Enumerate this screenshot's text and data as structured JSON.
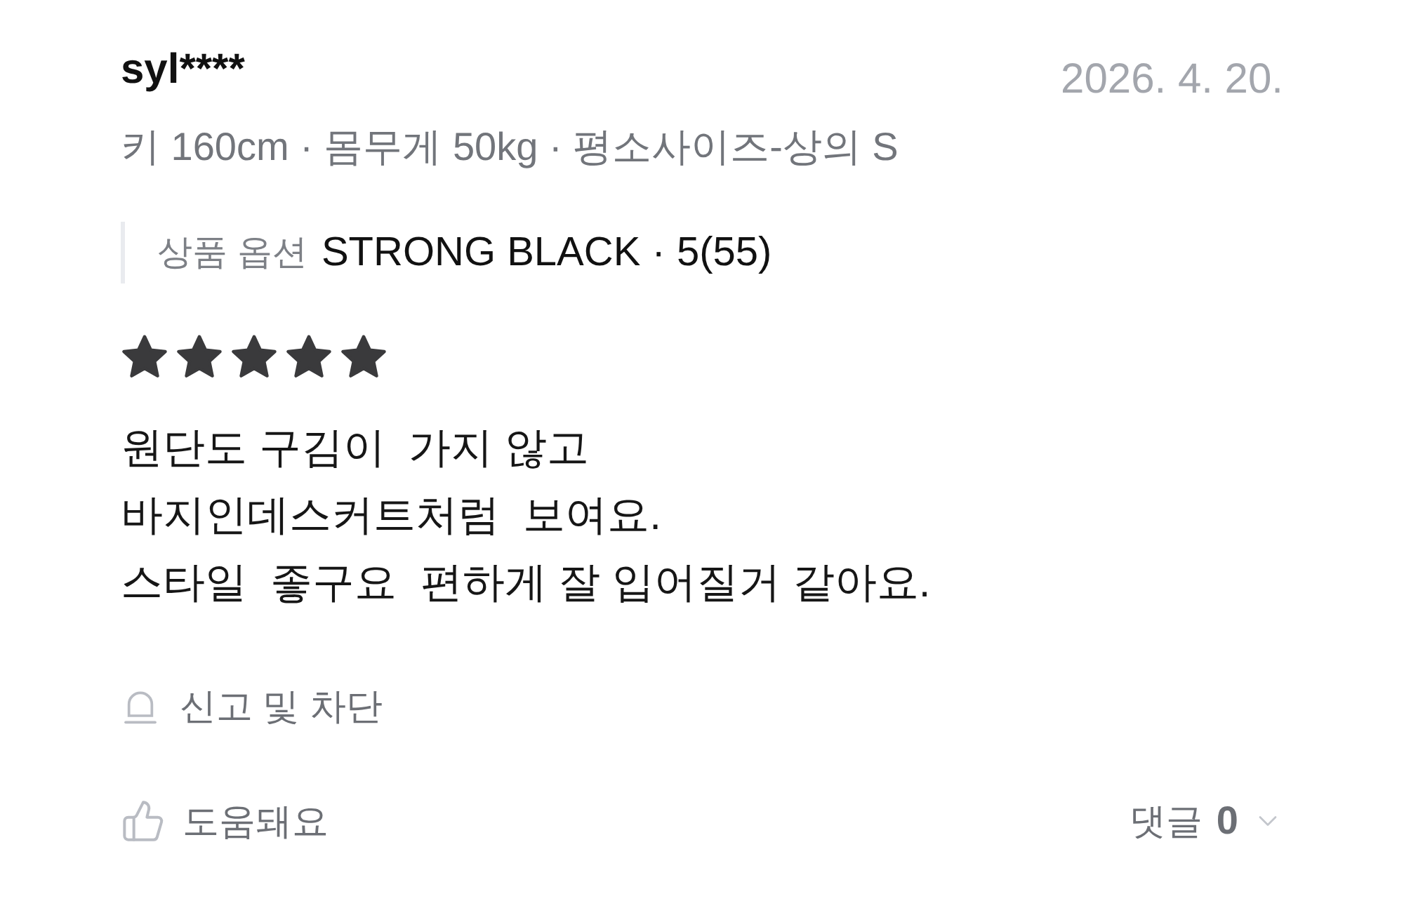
{
  "review": {
    "author": "syl****",
    "date": "2026. 4. 20.",
    "body_info": "키 160cm · 몸무게 50kg · 평소사이즈-상의 S",
    "option": {
      "label": "상품 옵션",
      "value": "STRONG BLACK · 5(55)"
    },
    "stars": 5,
    "text_lines": [
      "원단도 구김이  가지 않고",
      "바지인데스커트처럼  보여요.",
      "스타일  좋구요  편하게 잘 입어질거 같아요."
    ],
    "report": "신고 및 차단",
    "helpful": "도움돼요",
    "comments": {
      "label": "댓글",
      "count": "0"
    }
  }
}
